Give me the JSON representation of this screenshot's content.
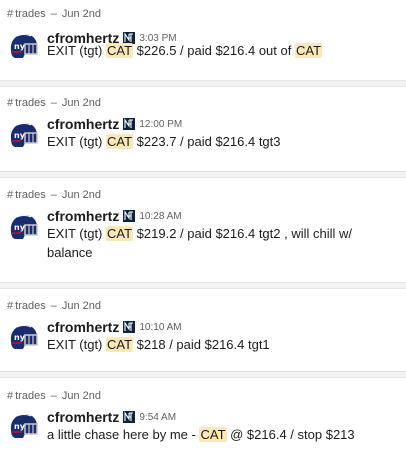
{
  "messages": [
    {
      "channel": "trades",
      "date": "Jun 2nd",
      "user": "cfromhertz",
      "time": "3:03 PM",
      "parts": [
        "EXIT (tgt) ",
        "CAT",
        " $226.5 / paid $216.4 out of ",
        "CAT",
        ""
      ]
    },
    {
      "channel": "trades",
      "date": "Jun 2nd",
      "user": "cfromhertz",
      "time": "12:00 PM",
      "parts": [
        "EXIT (tgt) ",
        "CAT",
        " $223.7 / paid $216.4 tgt3"
      ]
    },
    {
      "channel": "trades",
      "date": "Jun 2nd",
      "user": "cfromhertz",
      "time": "10:28 AM",
      "parts": [
        "EXIT (tgt) ",
        "CAT",
        " $219.2 / paid $216.4 tgt2 , will chill w/ balance"
      ]
    },
    {
      "channel": "trades",
      "date": "Jun 2nd",
      "user": "cfromhertz",
      "time": "10:10 AM",
      "parts": [
        "EXIT (tgt) ",
        "CAT",
        " $218 / paid $216.4 tgt1"
      ]
    },
    {
      "channel": "trades",
      "date": "Jun 2nd",
      "user": "cfromhertz",
      "time": "9:54 AM",
      "parts": [
        "a little chase here by me - ",
        "CAT",
        " @ $216.4 / stop $213"
      ]
    }
  ],
  "icons": {
    "avatar": "giants-helmet-icon",
    "badge": "yankees-logo-icon"
  },
  "colors": {
    "highlight": "#fbe8b9",
    "meta_text": "#616061",
    "separator": "#f2f2f2"
  }
}
